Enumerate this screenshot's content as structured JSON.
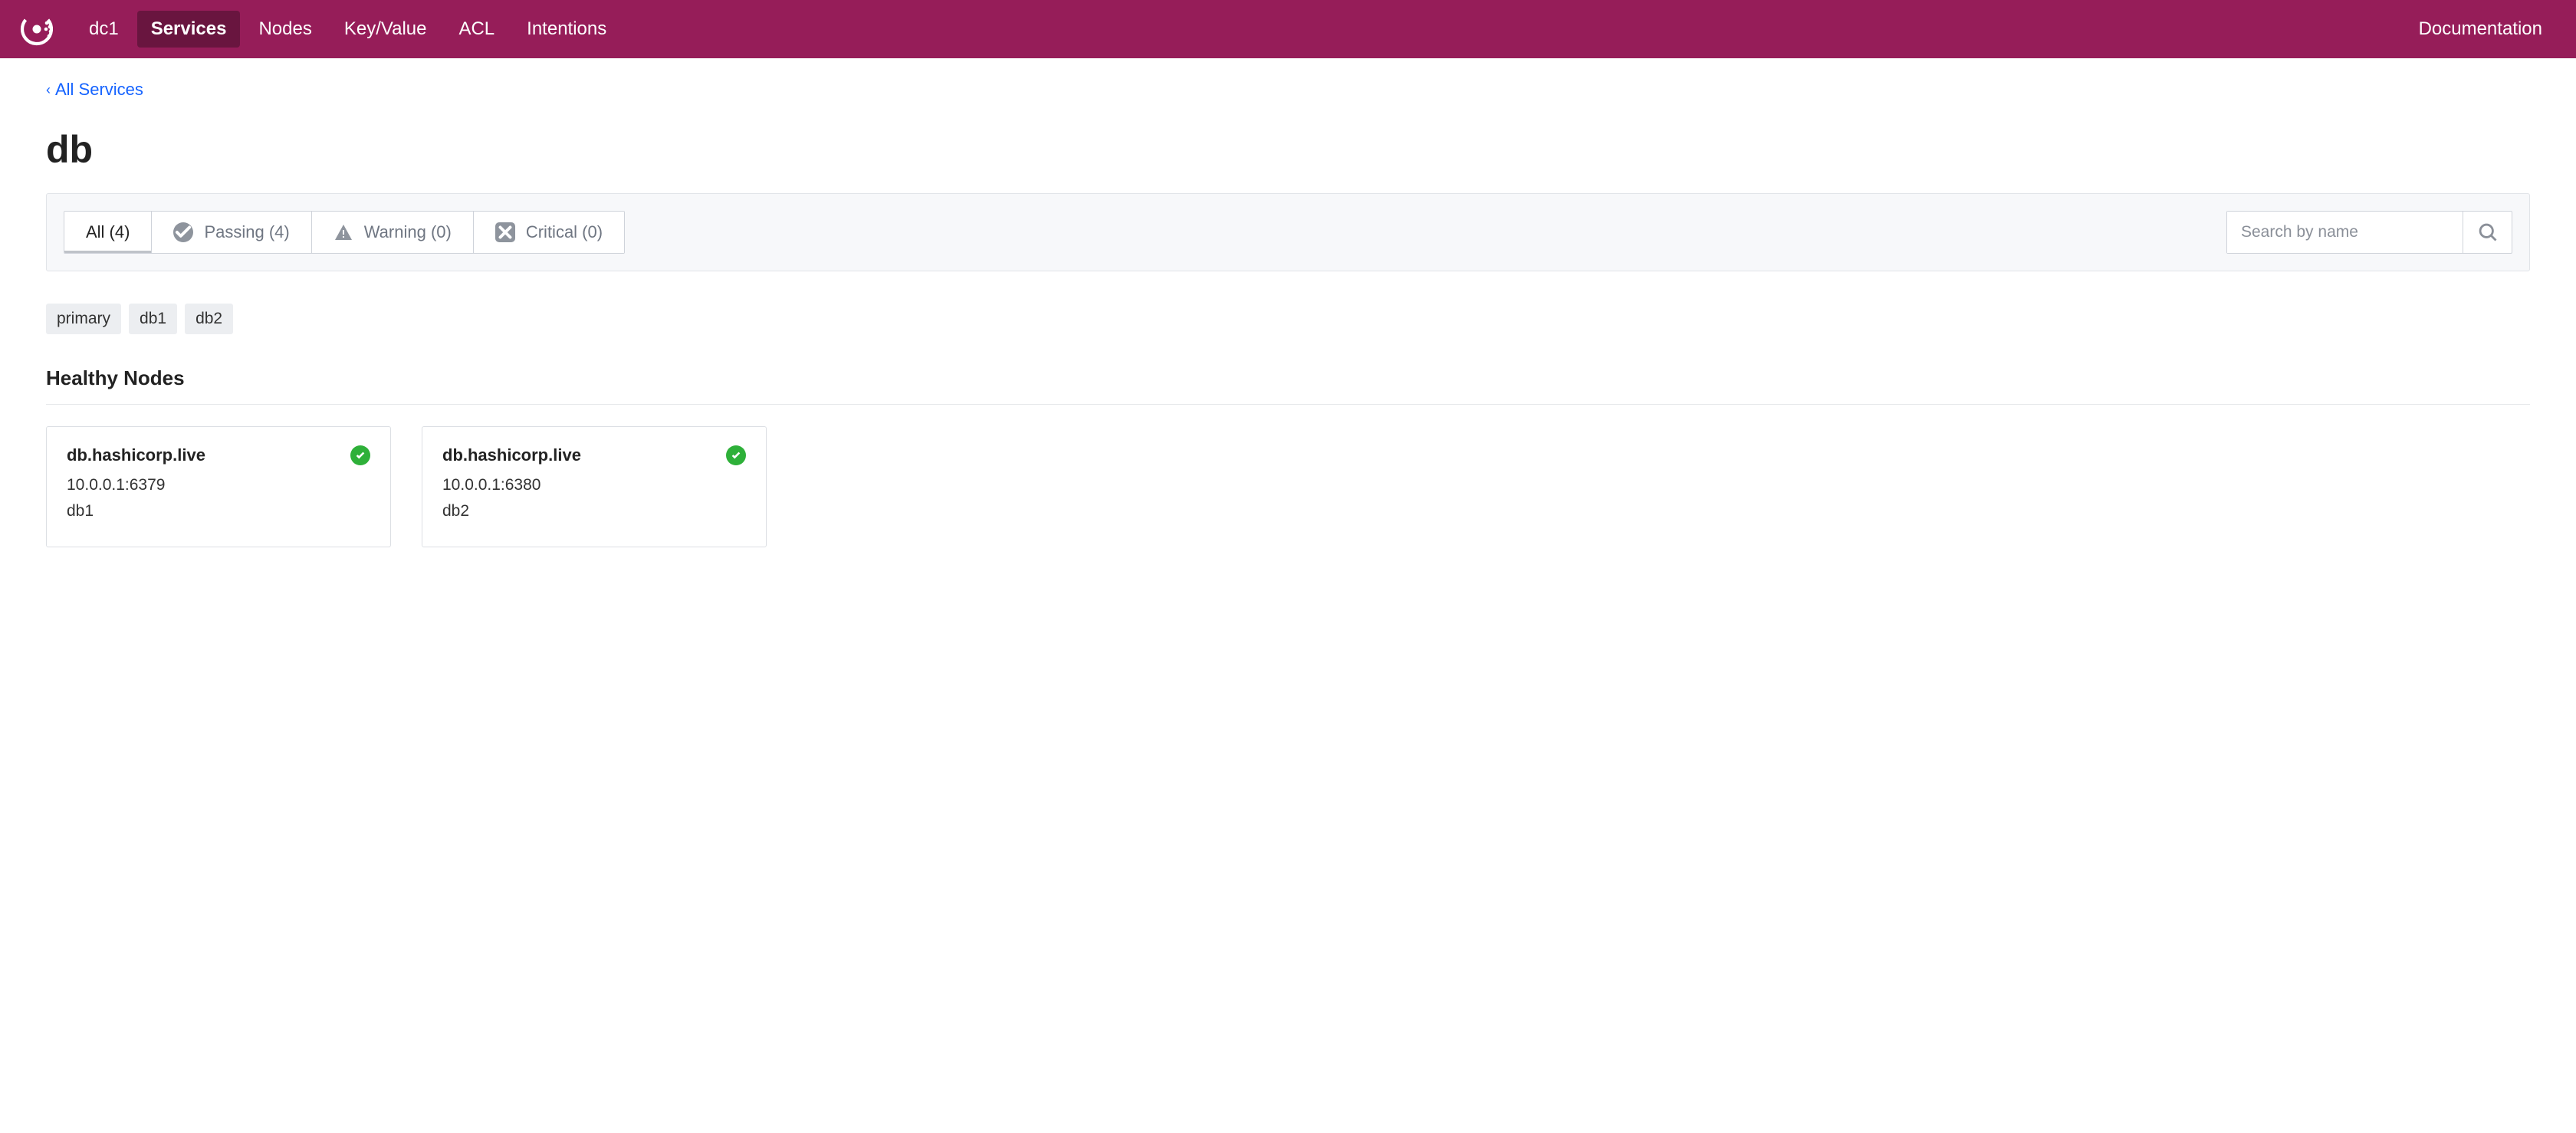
{
  "nav": {
    "datacenter": "dc1",
    "items": [
      {
        "label": "Services",
        "active": true
      },
      {
        "label": "Nodes",
        "active": false
      },
      {
        "label": "Key/Value",
        "active": false
      },
      {
        "label": "ACL",
        "active": false
      },
      {
        "label": "Intentions",
        "active": false
      }
    ],
    "doc_link": "Documentation"
  },
  "breadcrumb": {
    "label": "All Services"
  },
  "page_title": "db",
  "filters": {
    "all": {
      "label": "All (4)"
    },
    "passing": {
      "label": "Passing (4)"
    },
    "warning": {
      "label": "Warning (0)"
    },
    "critical": {
      "label": "Critical (0)"
    }
  },
  "search": {
    "placeholder": "Search by name"
  },
  "tags": [
    "primary",
    "db1",
    "db2"
  ],
  "section_title": "Healthy Nodes",
  "nodes": [
    {
      "name": "db.hashicorp.live",
      "address": "10.0.0.1:6379",
      "id": "db1",
      "status": "passing"
    },
    {
      "name": "db.hashicorp.live",
      "address": "10.0.0.1:6380",
      "id": "db2",
      "status": "passing"
    }
  ]
}
